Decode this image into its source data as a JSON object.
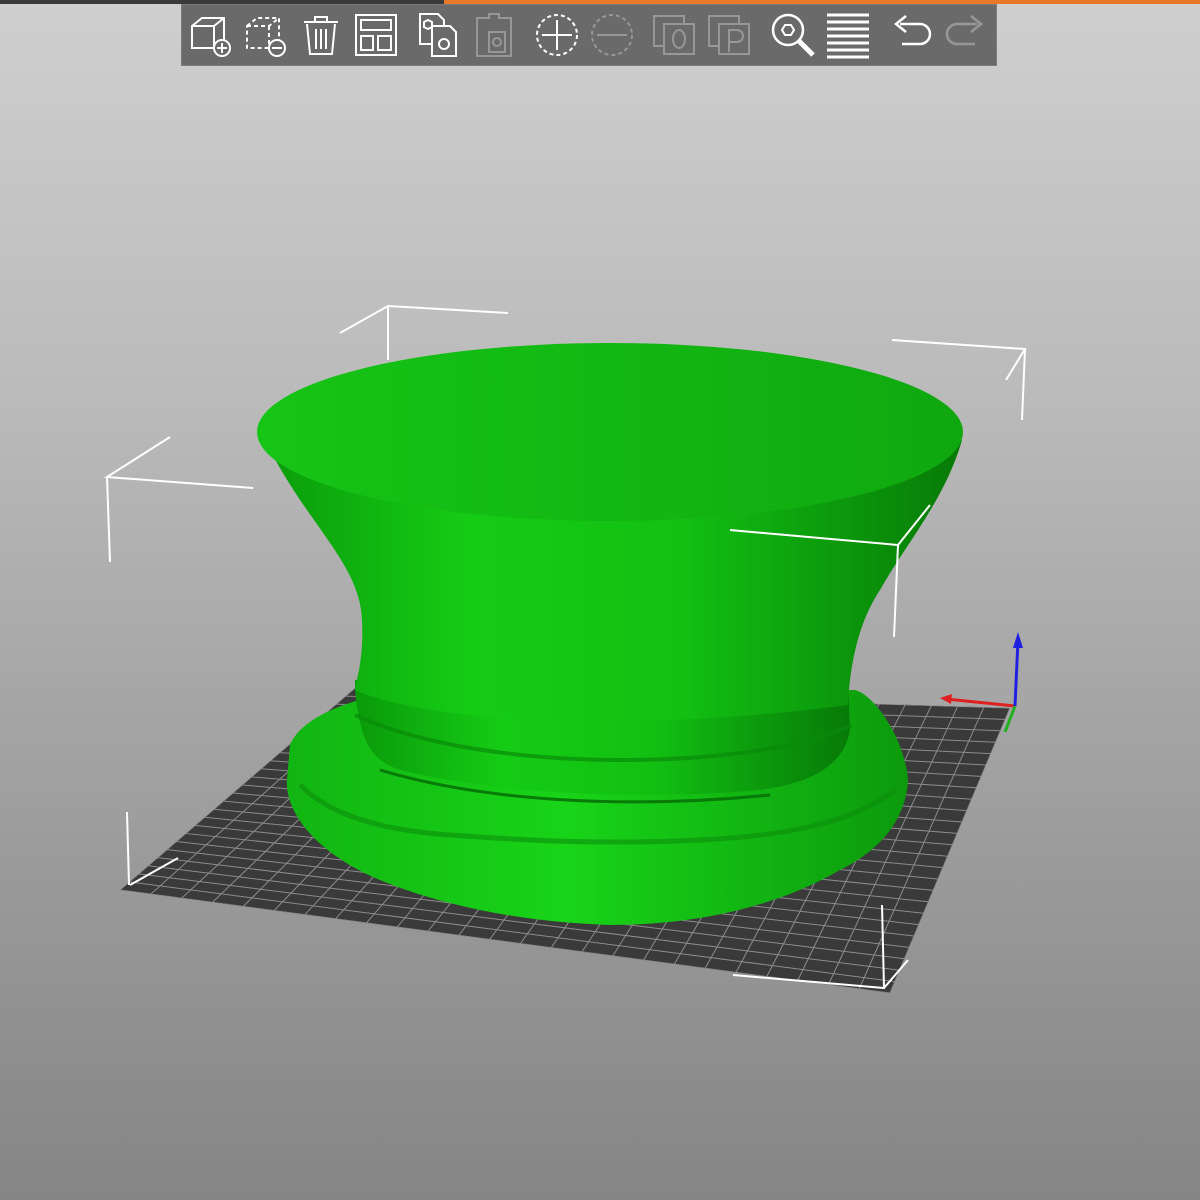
{
  "app": {
    "accent_color": "#e8782a",
    "background_top": "#cfcfcf",
    "background_bottom": "#858585"
  },
  "toolbar": {
    "buttons": [
      {
        "icon": "add-object-icon",
        "enabled": true
      },
      {
        "icon": "delete-object-icon",
        "enabled": true
      },
      {
        "icon": "delete-all-icon",
        "enabled": true
      },
      {
        "icon": "arrange-icon",
        "enabled": true
      },
      {
        "icon": "copy-icon",
        "enabled": true
      },
      {
        "icon": "paste-icon",
        "enabled": false
      },
      {
        "icon": "add-instance-icon",
        "enabled": true
      },
      {
        "icon": "remove-instance-icon",
        "enabled": false
      },
      {
        "icon": "split-to-objects-icon",
        "enabled": false,
        "label": "O"
      },
      {
        "icon": "split-to-parts-icon",
        "enabled": false,
        "label": "P"
      },
      {
        "icon": "search-icon",
        "enabled": true
      },
      {
        "icon": "layers-editing-icon",
        "enabled": true
      },
      {
        "icon": "undo-icon",
        "enabled": true
      },
      {
        "icon": "redo-icon",
        "enabled": false
      }
    ]
  },
  "scene": {
    "model_color": "#11c411",
    "bed_color": "#3a3a3a",
    "bed_grid_color": "#8c8c8c",
    "axis_colors": {
      "x": "#e02020",
      "y": "#20b020",
      "z": "#2020e0"
    }
  }
}
